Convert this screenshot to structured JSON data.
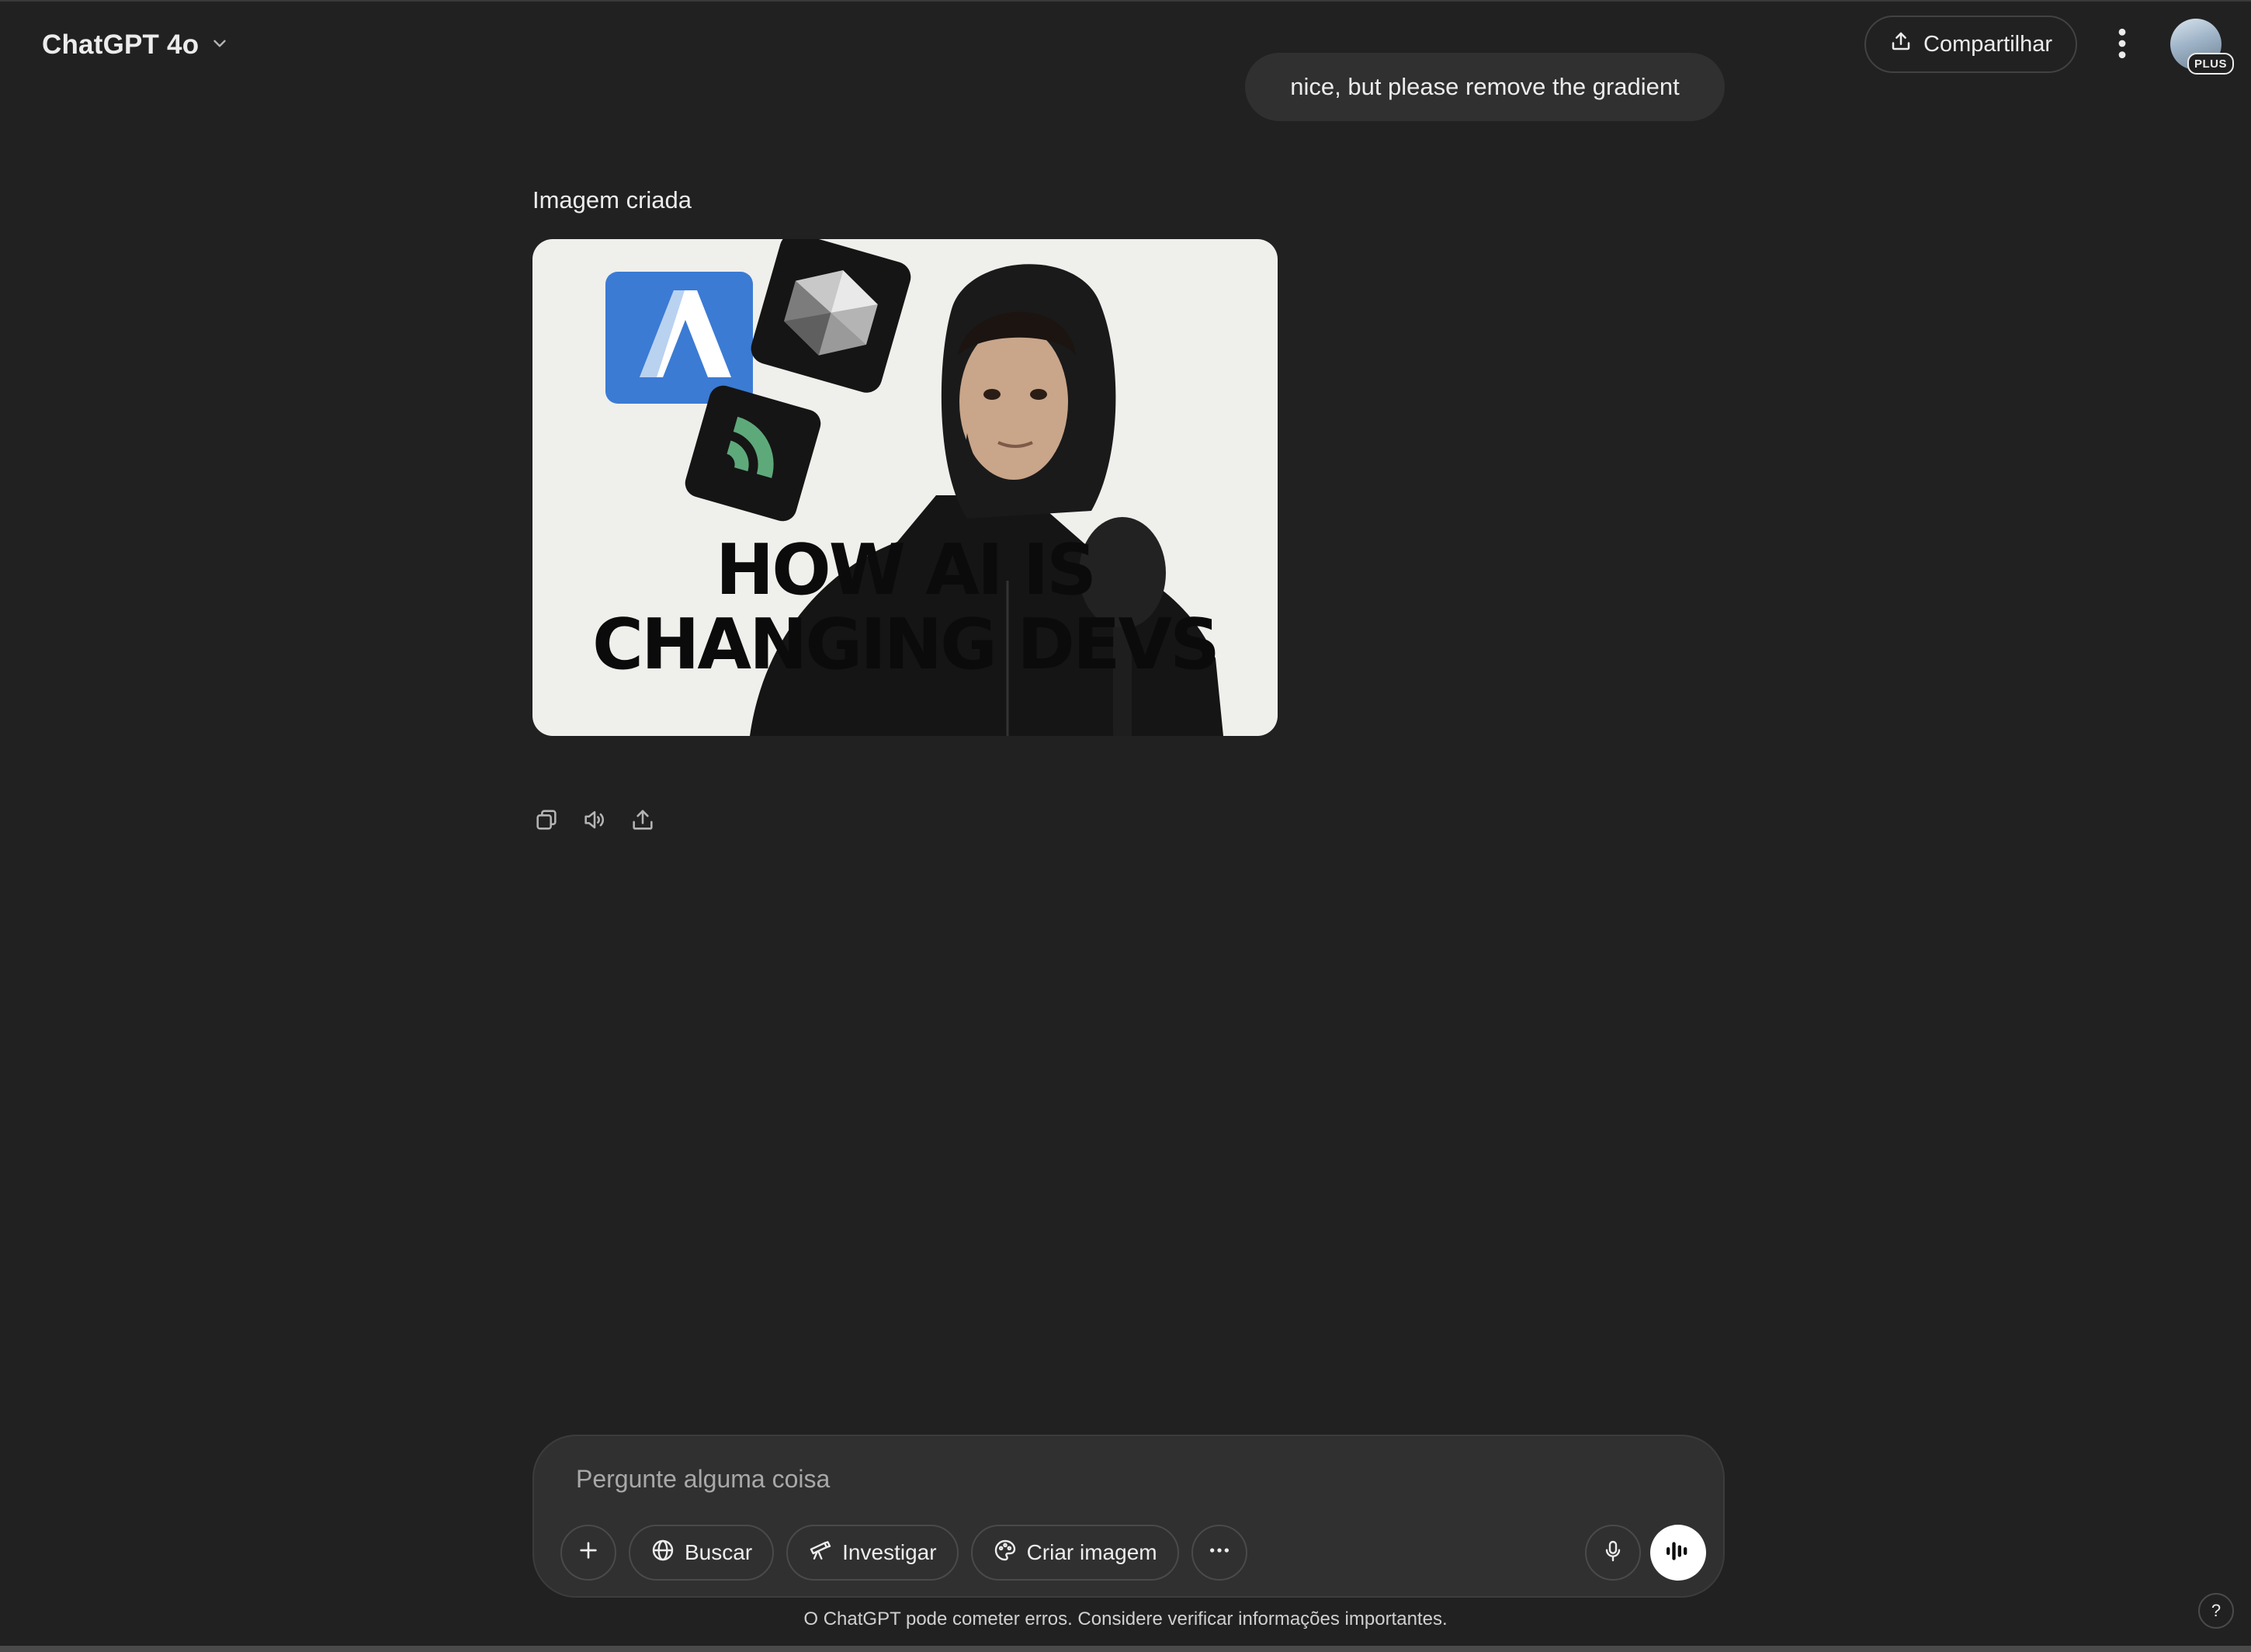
{
  "header": {
    "model_name": "ChatGPT 4o",
    "share_label": "Compartilhar",
    "plus_badge": "PLUS"
  },
  "conversation": {
    "user_message": "nice, but please remove the gradient",
    "assistant_label": "Imagem criada",
    "image": {
      "headline_line1": "HOW AI IS",
      "headline_line2": "CHANGING DEVS"
    }
  },
  "composer": {
    "placeholder": "Pergunte alguma coisa",
    "tools": {
      "search": "Buscar",
      "research": "Investigar",
      "create_image": "Criar imagem"
    }
  },
  "footer": {
    "disclaimer": "O ChatGPT pode cometer erros. Considere verificar informações importantes.",
    "help": "?"
  },
  "icons": {
    "model_chevron": "chevron-down-icon",
    "share": "share-icon",
    "more": "more-vertical-icon",
    "copy": "copy-icon",
    "read_aloud": "speaker-icon",
    "export": "upload-icon",
    "add": "plus-icon",
    "search": "globe-icon",
    "research": "telescope-icon",
    "create_image": "palette-icon",
    "more_tools": "more-horizontal-icon",
    "mic": "microphone-icon",
    "voice": "voice-waveform-icon"
  },
  "colors": {
    "background": "#212121",
    "bubble": "#303030",
    "text": "#ececec",
    "image_background": "#efefec",
    "logo_blue": "#3b7bd4",
    "logo_green": "#5ea97a"
  }
}
